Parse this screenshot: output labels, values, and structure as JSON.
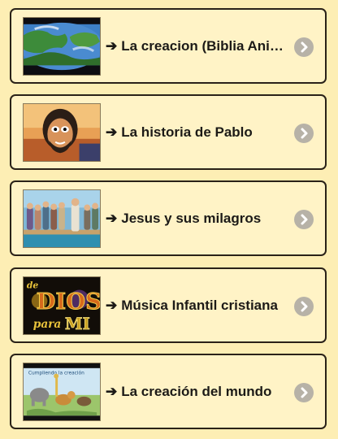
{
  "items": [
    {
      "label": "La creacion (Biblia Animada)",
      "arrow": "➔",
      "thumbnail": "earth-globe-image",
      "action_icon": "chevron-right-icon"
    },
    {
      "label": "La historia de Pablo",
      "arrow": "➔",
      "thumbnail": "cartoon-man-image",
      "action_icon": "chevron-right-icon"
    },
    {
      "label": "Jesus y sus milagros",
      "arrow": "➔",
      "thumbnail": "crowd-scene-image",
      "action_icon": "chevron-right-icon"
    },
    {
      "label": "Música Infantil cristiana",
      "arrow": "➔",
      "thumbnail": "de-dios-para-mi-logo",
      "action_icon": "chevron-right-icon",
      "logo_text": "de Dios para MI"
    },
    {
      "label": "La creación del mundo",
      "arrow": "➔",
      "thumbnail": "animals-creation-image",
      "action_icon": "chevron-right-icon",
      "thumbnail_caption": "Cumpliendo la creación"
    }
  ],
  "colors": {
    "background": "#fdeeb4",
    "card": "#fff3c6",
    "border": "#2a2218",
    "chevron_bg": "#b7b2a7"
  }
}
